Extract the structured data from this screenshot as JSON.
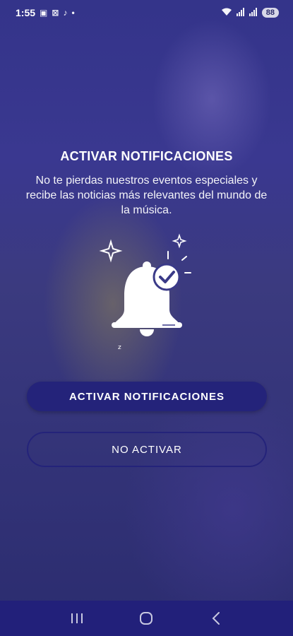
{
  "status_bar": {
    "time": "1:55",
    "battery": "88"
  },
  "content": {
    "title": "ACTIVAR NOTIFICACIONES",
    "description": "No te pierdas nuestros eventos especiales y recibe las noticias más relevantes del mundo de la música."
  },
  "buttons": {
    "activate_label": "ACTIVAR NOTIFICACIONES",
    "decline_label": "NO ACTIVAR"
  },
  "icons": {
    "bell": "bell-check-icon",
    "recents": "recents-icon",
    "home": "home-icon",
    "back": "back-icon"
  },
  "colors": {
    "background": "#34348a",
    "button_primary": "#24237a",
    "nav_bar": "#22207a"
  }
}
